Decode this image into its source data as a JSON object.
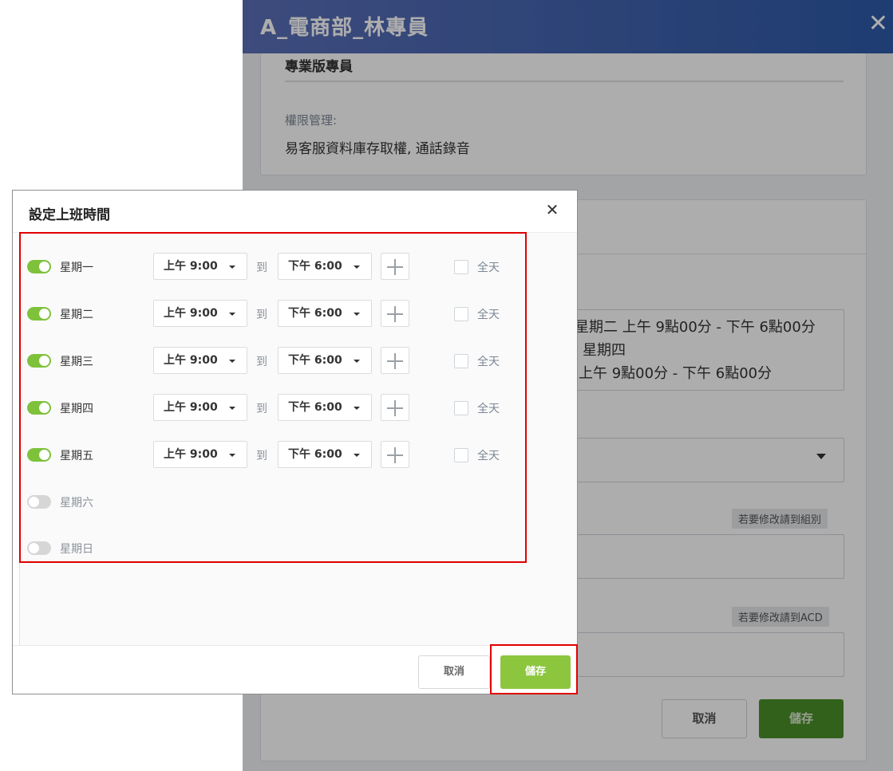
{
  "background": {
    "header_title": "A_電商部_林專員",
    "close_symbol": "✕",
    "role_name": "專業版專員",
    "permission_label": "權限管理:",
    "permission_value": "易客服資料庫存取權, 通話錄音",
    "schedule_lines": [
      "星期二  上午 9點00分 - 下午 6點00分",
      "星期四",
      "上午 9點00分 - 下午 6點00分"
    ],
    "group_hint": "若要修改請到組別",
    "acd_hint": "若要修改請到ACD",
    "cancel_label": "取消",
    "save_label": "儲存"
  },
  "dialog": {
    "title": "設定上班時間",
    "close_symbol": "✕",
    "to_label": "到",
    "all_day_label": "全天",
    "days": [
      {
        "label": "星期一",
        "enabled": true,
        "start": "上午  9:00",
        "end": "下午  6:00"
      },
      {
        "label": "星期二",
        "enabled": true,
        "start": "上午  9:00",
        "end": "下午  6:00"
      },
      {
        "label": "星期三",
        "enabled": true,
        "start": "上午  9:00",
        "end": "下午  6:00"
      },
      {
        "label": "星期四",
        "enabled": true,
        "start": "上午  9:00",
        "end": "下午  6:00"
      },
      {
        "label": "星期五",
        "enabled": true,
        "start": "上午  9:00",
        "end": "下午  6:00"
      },
      {
        "label": "星期六",
        "enabled": false
      },
      {
        "label": "星期日",
        "enabled": false
      }
    ],
    "cancel_label": "取消",
    "save_label": "儲存"
  },
  "colors": {
    "header_gradient_start": "#5b6fb8",
    "header_gradient_end": "#2d5aa8",
    "toggle_on": "#7ec23b",
    "save_button": "#8cc63f",
    "highlight_border": "#e00000"
  }
}
